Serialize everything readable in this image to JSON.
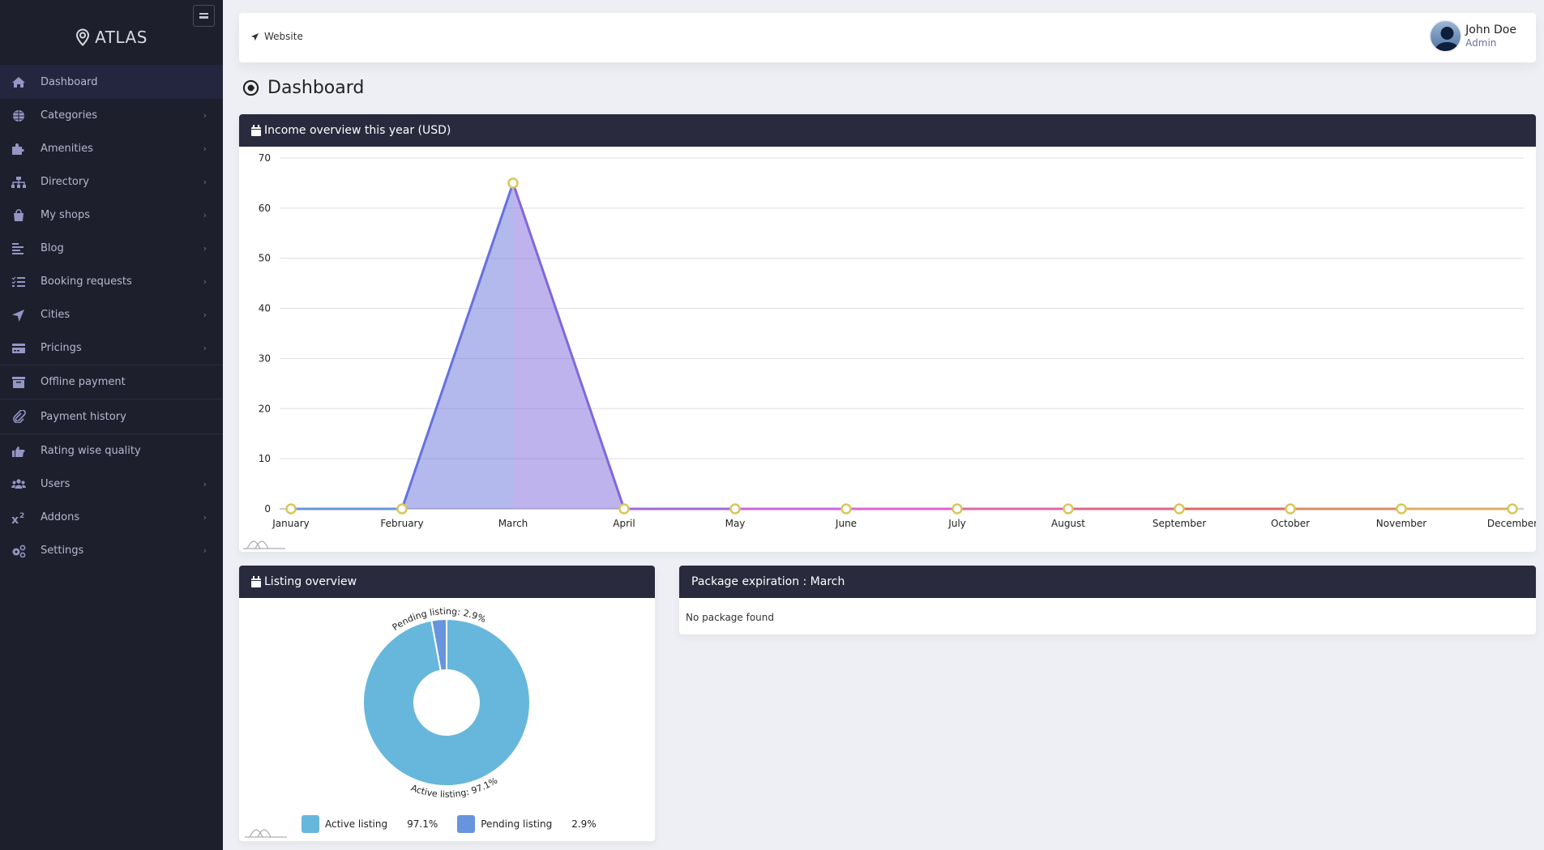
{
  "sidebar": {
    "brand": "ATLAS",
    "items": [
      {
        "label": "Dashboard",
        "icon": "home-icon",
        "has_children": false,
        "active": true
      },
      {
        "label": "Categories",
        "icon": "globe-icon",
        "has_children": true
      },
      {
        "label": "Amenities",
        "icon": "puzzle-icon",
        "has_children": true
      },
      {
        "label": "Directory",
        "icon": "sitemap-icon",
        "has_children": true
      },
      {
        "label": "My shops",
        "icon": "shopping-bag-icon",
        "has_children": true
      },
      {
        "label": "Blog",
        "icon": "align-left-icon",
        "has_children": true
      },
      {
        "label": "Booking requests",
        "icon": "tasks-icon",
        "has_children": true
      },
      {
        "label": "Cities",
        "icon": "location-arrow-icon",
        "has_children": true
      },
      {
        "label": "Pricings",
        "icon": "credit-card-icon",
        "has_children": true
      },
      {
        "label": "Offline payment",
        "icon": "archive-icon",
        "has_children": false
      },
      {
        "label": "Payment history",
        "icon": "paperclip-icon",
        "has_children": false
      },
      {
        "label": "Rating wise quality",
        "icon": "thumbs-up-icon",
        "has_children": false
      },
      {
        "label": "Users",
        "icon": "users-icon",
        "has_children": true
      },
      {
        "label": "Addons",
        "icon": "superscript-icon",
        "has_children": true
      },
      {
        "label": "Settings",
        "icon": "cogs-icon",
        "has_children": true
      }
    ],
    "chevron": "›"
  },
  "topbar": {
    "website_label": "Website",
    "user_name": "John Doe",
    "user_role": "Admin"
  },
  "page": {
    "title": "Dashboard"
  },
  "income_card": {
    "title": "Income overview this year (USD)"
  },
  "listing_card": {
    "title": "Listing overview"
  },
  "package_card": {
    "title": "Package expiration : March",
    "empty_text": "No package found"
  },
  "colors": {
    "sidebar_bg": "#1e1f2c",
    "card_header_bg": "#292a3d",
    "active_color": "#67b7dc",
    "pending_color": "#6794dc",
    "bullet_color": "#d8c75a"
  },
  "chart_data": [
    {
      "type": "area",
      "title": "Income overview this year (USD)",
      "xlabel": "",
      "ylabel": "",
      "categories": [
        "January",
        "February",
        "March",
        "April",
        "May",
        "June",
        "July",
        "August",
        "September",
        "October",
        "November",
        "December"
      ],
      "values": [
        0,
        0,
        65,
        0,
        0,
        0,
        0,
        0,
        0,
        0,
        0,
        0
      ],
      "ylim": [
        0,
        70
      ],
      "yticks": [
        0,
        10,
        20,
        30,
        40,
        50,
        60,
        70
      ],
      "grid": true,
      "legend": "none"
    },
    {
      "type": "pie",
      "title": "Listing overview",
      "donut": true,
      "slices": [
        {
          "label": "Active listing",
          "value": 97.1,
          "display": "97.1%",
          "color": "#67b7dc"
        },
        {
          "label": "Pending listing",
          "value": 2.9,
          "display": "2.9%",
          "color": "#6794dc"
        }
      ],
      "legend": "bottom"
    }
  ]
}
